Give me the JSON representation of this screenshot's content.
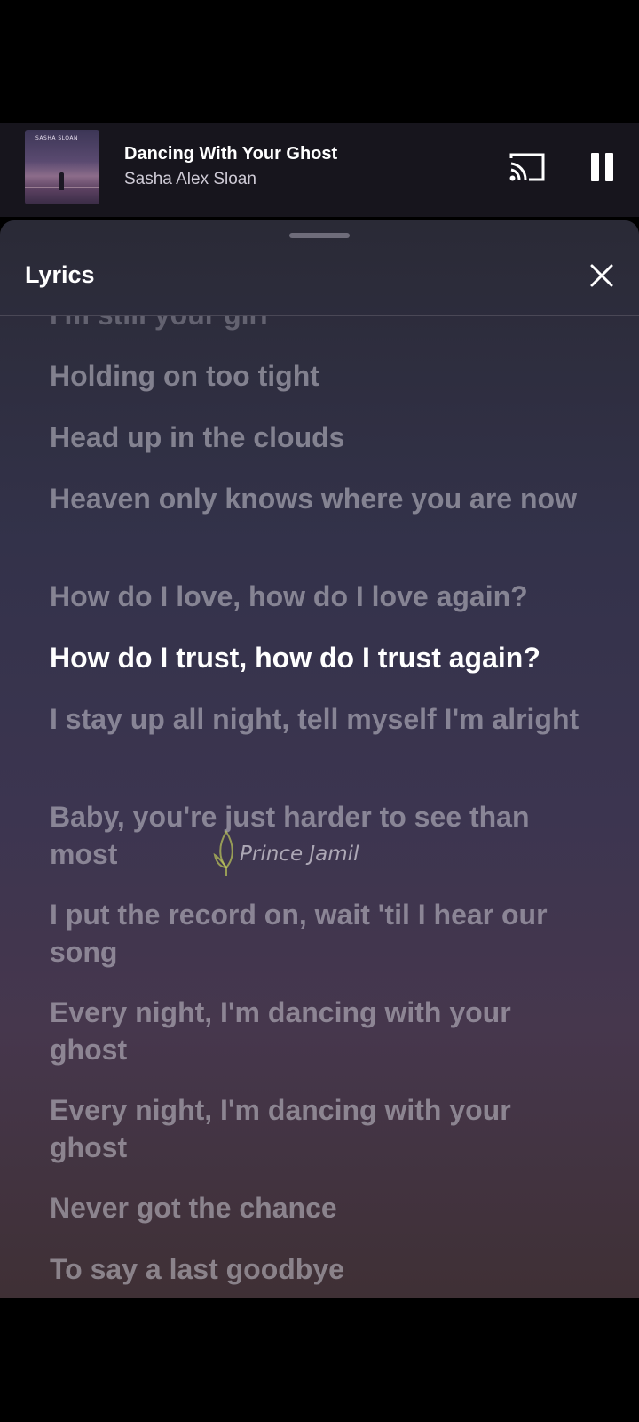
{
  "now_playing": {
    "title": "Dancing With Your Ghost",
    "artist": "Sasha Alex Sloan",
    "art_text": "SASHA SLOAN"
  },
  "controls": {
    "cast_icon": "cast-icon",
    "pause_icon": "pause-icon"
  },
  "sheet": {
    "title": "Lyrics",
    "close_icon": "close-icon"
  },
  "lyrics": [
    "I'm still your girl",
    "Holding on too tight",
    "Head up in the clouds",
    "Heaven only knows where you are now",
    "How do I love, how do I love again?",
    "How do I trust, how do I trust again?",
    "I stay up all night, tell myself I'm alright",
    "Baby, you're just harder to see than most",
    "I put the record on, wait 'til I hear our song",
    "Every night, I'm dancing with your ghost",
    "Every night, I'm dancing with your ghost",
    "Never got the chance",
    "To say a last goodbye"
  ],
  "active_lyric_index": 5,
  "watermark": "Prince Jamil",
  "colors": {
    "active_lyric": "#ffffff",
    "inactive_lyric": "#c8c6d0"
  }
}
